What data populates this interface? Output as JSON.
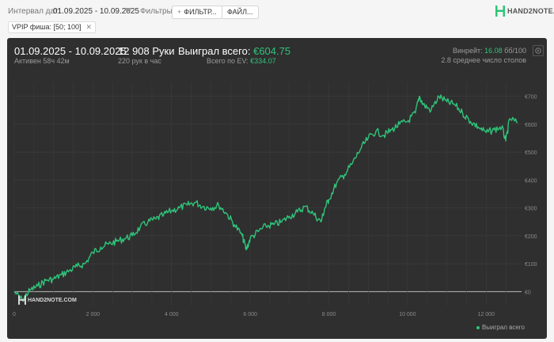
{
  "toolbar": {
    "date_label": "Интервал дат:",
    "date_value": "01.09.2025 - 10.09.2025",
    "filters_label": "Фильтры:",
    "filters_button": "ФИЛЬТР...",
    "file_button": "ФАЙЛ...",
    "logo_text": "HAND2NOTE.COM"
  },
  "active_filter": {
    "label": "VPIP фиша: [50; 100]"
  },
  "stats": {
    "date_range": "01.09.2025 - 10.09.2025",
    "active_time": "Активен 58ч 42м",
    "hands": "12 908 Руки",
    "hands_per_hour": "220 рук в час",
    "won_label": "Выиграл всего:",
    "won_value": "€604.75",
    "ev_label": "Всего по EV:",
    "ev_value": "€334.07",
    "winrate_label": "Винрейт:",
    "winrate_value": "16.08",
    "winrate_unit": "бб/100",
    "avg_tables": "2.8 среднее число столов"
  },
  "watermark": "HAND2NOTE.COM",
  "colors": {
    "line": "#2fc47a",
    "panel": "#2f2f2f"
  },
  "chart_data": {
    "type": "line",
    "x_ticks": [
      "0",
      "2 000",
      "4 000",
      "6 000",
      "8 000",
      "10 000",
      "12 000"
    ],
    "y_ticks": [
      "€0",
      "€100",
      "€200",
      "€300",
      "€400",
      "€500",
      "€600",
      "€700"
    ],
    "xlim": [
      0,
      12900
    ],
    "ylim": [
      -50,
      750
    ],
    "grid": true,
    "series": [
      {
        "name": "Выиграл всего",
        "x": [
          0,
          200,
          400,
          600,
          800,
          1000,
          1200,
          1400,
          1600,
          1800,
          2000,
          2200,
          2400,
          2600,
          2800,
          3000,
          3200,
          3400,
          3600,
          3800,
          4000,
          4200,
          4400,
          4600,
          4800,
          5000,
          5200,
          5400,
          5600,
          5800,
          5900,
          6000,
          6200,
          6400,
          6600,
          6800,
          7000,
          7200,
          7400,
          7600,
          7800,
          7900,
          8000,
          8200,
          8400,
          8600,
          8800,
          9000,
          9200,
          9400,
          9600,
          9800,
          10000,
          10200,
          10300,
          10400,
          10600,
          10800,
          11000,
          11200,
          11400,
          11600,
          11800,
          12000,
          12200,
          12400,
          12500,
          12600,
          12800
        ],
        "y": [
          0,
          -30,
          5,
          20,
          40,
          45,
          60,
          75,
          90,
          100,
          140,
          160,
          170,
          180,
          190,
          200,
          230,
          250,
          260,
          275,
          290,
          300,
          310,
          320,
          305,
          300,
          310,
          280,
          240,
          200,
          150,
          190,
          215,
          235,
          240,
          250,
          270,
          285,
          305,
          280,
          250,
          300,
          330,
          390,
          420,
          460,
          510,
          550,
          575,
          560,
          580,
          600,
          610,
          640,
          700,
          670,
          650,
          700,
          680,
          670,
          640,
          610,
          590,
          570,
          580,
          590,
          540,
          620,
          605
        ]
      }
    ]
  }
}
